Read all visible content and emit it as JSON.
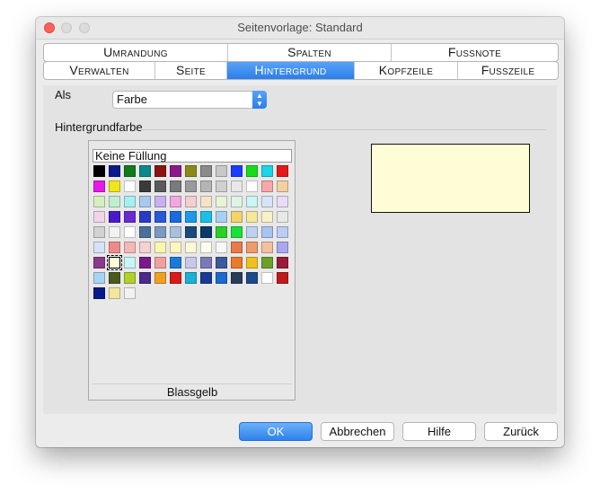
{
  "window": {
    "title": "Seitenvorlage: Standard"
  },
  "tabs_row1": [
    {
      "label": "Umrandung",
      "active": false
    },
    {
      "label": "Spalten",
      "active": false
    },
    {
      "label": "Fussnote",
      "active": false
    }
  ],
  "tabs_row2": [
    {
      "label": "Verwalten",
      "active": false
    },
    {
      "label": "Seite",
      "active": false
    },
    {
      "label": "Hintergrund",
      "active": true
    },
    {
      "label": "Kopfzeile",
      "active": false
    },
    {
      "label": "Fusszeile",
      "active": false
    }
  ],
  "form": {
    "as_label": "Als",
    "as_value": "Farbe",
    "section_label": "Hintergrundfarbe",
    "no_fill_label": "Keine Füllung",
    "selected_color_name": "Blassgelb",
    "preview_color": "#fffdd6"
  },
  "palette": [
    "#000000",
    "#0a1a8a",
    "#117a1a",
    "#0a8a8a",
    "#8a1410",
    "#8a1a8a",
    "#8a8a1a",
    "#8a8a8a",
    "#c8c8c8",
    "#1a3cff",
    "#1adb1a",
    "#1ad6e6",
    "#e61a1a",
    "#e61ae6",
    "#f0e61a",
    "#ffffff",
    "#3a3a3a",
    "#5a5a5a",
    "#7a7a7a",
    "#9a9a9a",
    "#b5b5b5",
    "#d0d0d0",
    "#e8e8e8",
    "#ffffff",
    "#f7a8a8",
    "#f2d0a0",
    "#d6efbf",
    "#bfefcf",
    "#a6f0f0",
    "#a8c8f0",
    "#c8b0f0",
    "#f0a8e0",
    "#f4cfcf",
    "#f5e3cc",
    "#e8f3d8",
    "#e0f3e5",
    "#ccf5f5",
    "#d5e4f7",
    "#e8dcf7",
    "#f4d4ed",
    "#4a1ac8",
    "#6a2ad0",
    "#2a3ac8",
    "#2a5ad8",
    "#1a6ae0",
    "#1a9ae8",
    "#1ac0e8",
    "#a8d0f0",
    "#f2d46a",
    "#f6e89a",
    "#faf1c8",
    "#e8e8e8",
    "#d2d2d2",
    "#f2f2f2",
    "#ffffff",
    "#4a6f9a",
    "#7a9ac0",
    "#a8c0dc",
    "#1a4a7a",
    "#0a3a6a",
    "#2ad02a",
    "#1ae03a",
    "#c0d0f0",
    "#a8c4f0",
    "#bccdf2",
    "#d5e3f8",
    "#f08a8a",
    "#f4b8b8",
    "#f7d0d0",
    "#faf6b0",
    "#fcf6c0",
    "#fdf8d8",
    "#fefdf0",
    "#f8f8f8",
    "#e87a4a",
    "#f09a6a",
    "#f4c0a0",
    "#a8a8f0",
    "#8a3a8a",
    "#fffdd6",
    "#c8f5f5",
    "#7a1a8a",
    "#f0a0a0",
    "#1a7ad8",
    "#c8c8e8",
    "#7a7ab8",
    "#3a5a9a",
    "#e87a2a",
    "#f0c020",
    "#6aa02a",
    "#9a1a3a",
    "#a8d4f4",
    "#4a5a1a",
    "#b0d02a",
    "#4a2a8a",
    "#f0a020",
    "#d81a1a",
    "#1ab0d8",
    "#1a3a9a",
    "#1a6ad0",
    "#2a3a5a",
    "#1a4a8a",
    "#ffffff",
    "#c01a1a",
    "#0a1a8a",
    "#f2e6a0",
    "#f2f2f2"
  ],
  "buttons": {
    "ok": "OK",
    "cancel": "Abbrechen",
    "help": "Hilfe",
    "back": "Zurück"
  }
}
